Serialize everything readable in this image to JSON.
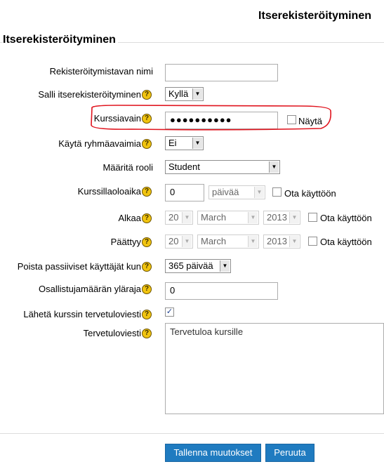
{
  "page_title": "Itserekisteröityminen",
  "section_title": "Itserekisteröityminen",
  "fields": {
    "instance_name": {
      "label": "Rekisteröitymistavan nimi",
      "value": ""
    },
    "allow_self_enrol": {
      "label": "Salli itserekisteröityminen",
      "value": "Kyllä"
    },
    "enrolment_key": {
      "label": "Kurssiavain",
      "masked_value": "●●●●●●●●●●",
      "show_label": "Näytä",
      "show_checked": false
    },
    "use_group_keys": {
      "label": "Käytä ryhmäavaimia",
      "value": "Ei"
    },
    "role": {
      "label": "Määritä rooli",
      "value": "Student"
    },
    "enrolment_duration": {
      "label": "Kurssillaoloaika",
      "number": "0",
      "unit": "päivää",
      "enable_label": "Ota käyttöön",
      "enabled": false
    },
    "start_date": {
      "label": "Alkaa",
      "day": "20",
      "month": "March",
      "year": "2013",
      "enable_label": "Ota käyttöön",
      "enabled": false
    },
    "end_date": {
      "label": "Päättyy",
      "day": "20",
      "month": "March",
      "year": "2013",
      "enable_label": "Ota käyttöön",
      "enabled": false
    },
    "unenrol_inactive": {
      "label": "Poista passiiviset käyttäjät kun",
      "value": "365 päivää"
    },
    "max_enrolled": {
      "label": "Osallistujamäärän yläraja",
      "value": "0"
    },
    "send_welcome": {
      "label": "Lähetä kurssin tervetuloviesti",
      "checked": true
    },
    "welcome_message": {
      "label": "Tervetuloviesti",
      "value": "Tervetuloa kursille"
    }
  },
  "help_icon_glyph": "?",
  "buttons": {
    "save": "Tallenna muutokset",
    "cancel": "Peruuta"
  },
  "colors": {
    "highlight_outline": "#e0141e",
    "button_bg": "#1f7bc0",
    "help_icon": "#f1c40f"
  }
}
